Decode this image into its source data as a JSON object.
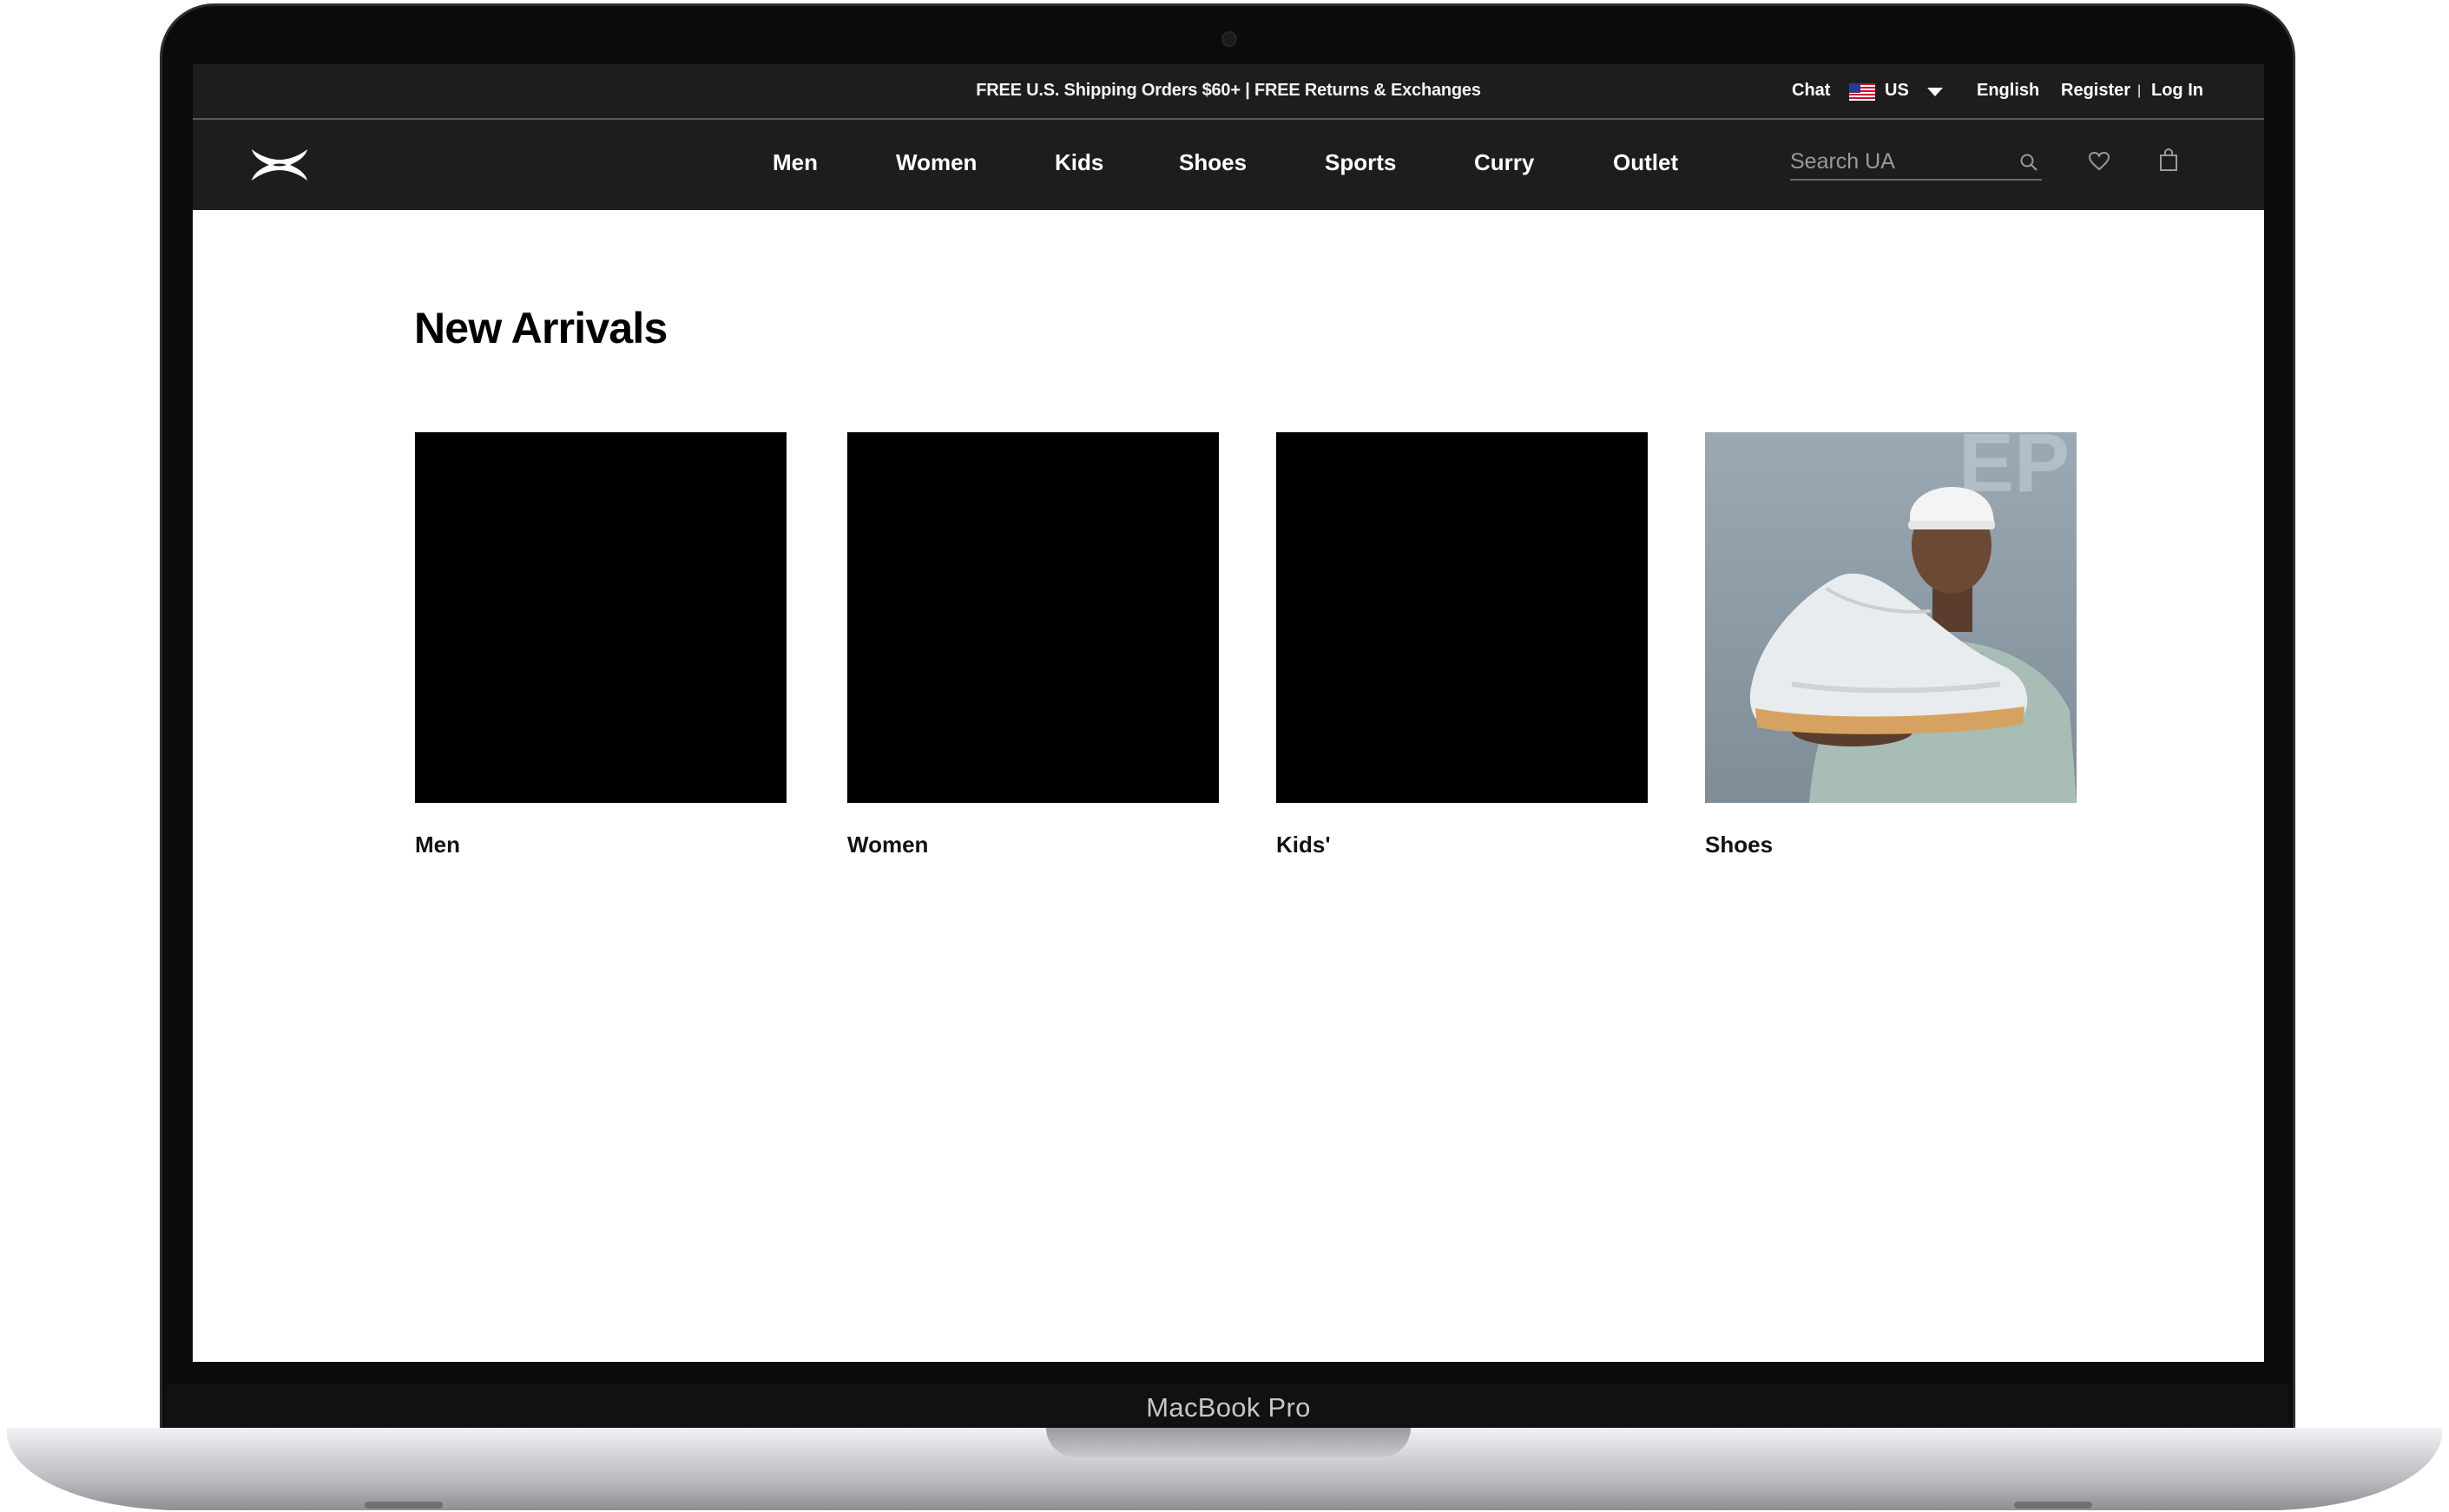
{
  "device": {
    "model_label": "MacBook Pro"
  },
  "topbar": {
    "promo": "FREE U.S. Shipping Orders $60+ | FREE Returns & Exchanges",
    "chat": "Chat",
    "country": "US",
    "language": "English",
    "register": "Register",
    "separator": "|",
    "login": "Log In"
  },
  "nav": {
    "items": [
      {
        "label": "Men"
      },
      {
        "label": "Women"
      },
      {
        "label": "Kids"
      },
      {
        "label": "Shoes"
      },
      {
        "label": "Sports"
      },
      {
        "label": "Curry"
      },
      {
        "label": "Outlet"
      }
    ],
    "search_placeholder": "Search UA",
    "icons": [
      "search-icon",
      "heart-icon",
      "bag-icon"
    ]
  },
  "main": {
    "title": "New Arrivals",
    "cards": [
      {
        "label": "Men"
      },
      {
        "label": "Women"
      },
      {
        "label": "Kids'"
      },
      {
        "label": "Shoes"
      }
    ],
    "shoes_photo_text": "EP"
  },
  "colors": {
    "header_bg": "#1d1d1d",
    "page_bg": "#ffffff",
    "tile_bg": "#000000",
    "photo_bg": "#8e9ea9"
  }
}
